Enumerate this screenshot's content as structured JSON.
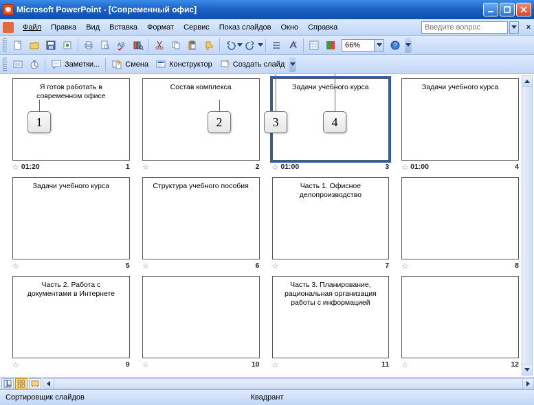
{
  "title": "Microsoft PowerPoint - [Современный офис]",
  "menu": {
    "file": "Файл",
    "edit": "Правка",
    "view": "Вид",
    "insert": "Вставка",
    "format": "Формат",
    "tools": "Сервис",
    "slideshow": "Показ слайдов",
    "window": "Окно",
    "help": "Справка"
  },
  "helpbox_placeholder": "Введите вопрос",
  "zoom": "66%",
  "toolbar2": {
    "notes": "Заметки...",
    "transition": "Смена",
    "design": "Конструктор",
    "new_slide": "Создать слайд"
  },
  "callouts": {
    "c1": "1",
    "c2": "2",
    "c3": "3",
    "c4": "4"
  },
  "slides": [
    {
      "title": "Я готов работать в современном офисе",
      "time": "01:20",
      "num": "1",
      "selected": false
    },
    {
      "title": "Состав комплекса",
      "time": "",
      "num": "2",
      "selected": false
    },
    {
      "title": "Задачи учебного курса",
      "time": "01:00",
      "num": "3",
      "selected": true
    },
    {
      "title": "Задачи учебного курса",
      "time": "01:00",
      "num": "4",
      "selected": false
    },
    {
      "title": "Задачи учебного курса",
      "time": "",
      "num": "5",
      "selected": false
    },
    {
      "title": "Структура учебного пособия",
      "time": "",
      "num": "6",
      "selected": false
    },
    {
      "title": "Часть 1. Офисное делопроизводство",
      "time": "",
      "num": "7",
      "selected": false
    },
    {
      "title": "",
      "time": "",
      "num": "8",
      "selected": false
    },
    {
      "title": "Часть 2. Работа с документами в Интернете",
      "time": "",
      "num": "9",
      "selected": false
    },
    {
      "title": "",
      "time": "",
      "num": "10",
      "selected": false
    },
    {
      "title": "Часть 3. Планирование, рациональная организация работы с информацией",
      "time": "",
      "num": "11",
      "selected": false
    },
    {
      "title": "",
      "time": "",
      "num": "12",
      "selected": false
    }
  ],
  "status": {
    "left": "Сортировщик слайдов",
    "center": "Квадрант"
  },
  "colors": {
    "accent": "#1a5fc2",
    "selection": "#2a5fb0"
  }
}
